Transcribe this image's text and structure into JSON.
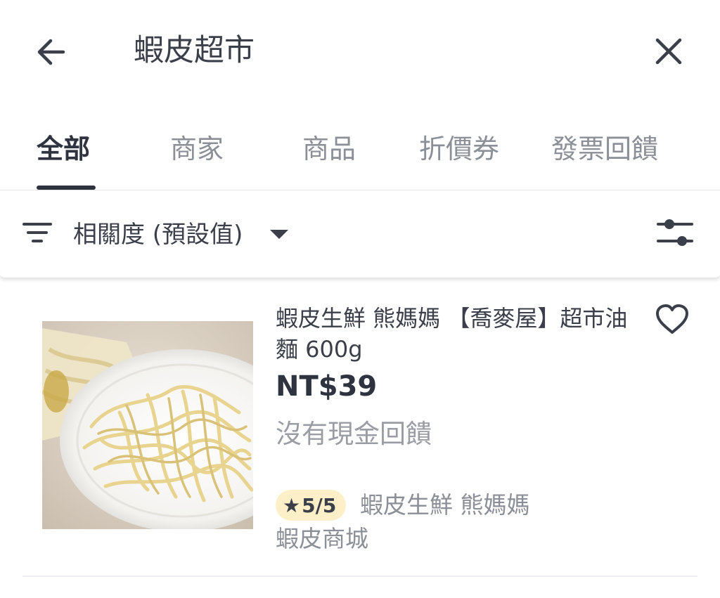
{
  "header": {
    "back_icon": "arrow-left-icon",
    "search_query": "蝦皮超市",
    "close_icon": "close-icon"
  },
  "tabs": [
    {
      "label": "全部",
      "active": true
    },
    {
      "label": "商家",
      "active": false
    },
    {
      "label": "商品",
      "active": false
    },
    {
      "label": "折價券",
      "active": false
    },
    {
      "label": "發票回饋",
      "active": false
    }
  ],
  "sort": {
    "icon": "sort-lines-icon",
    "label": "相關度 (預設值)",
    "caret_icon": "caret-down-icon",
    "filter_icon": "sliders-icon"
  },
  "product": {
    "title": "蝦皮生鮮 熊媽媽 【喬麥屋】超市油麵 600g",
    "price": "NT$39",
    "cashback": "沒有現金回饋",
    "rating": "5/5",
    "shop": "蝦皮生鮮 熊媽媽",
    "mall": "蝦皮商城",
    "favorite_icon": "heart-outline-icon"
  },
  "colors": {
    "text_primary": "#3b3f4a",
    "text_secondary": "#8b8f97",
    "rating_badge_bg": "#fdf0c8"
  }
}
